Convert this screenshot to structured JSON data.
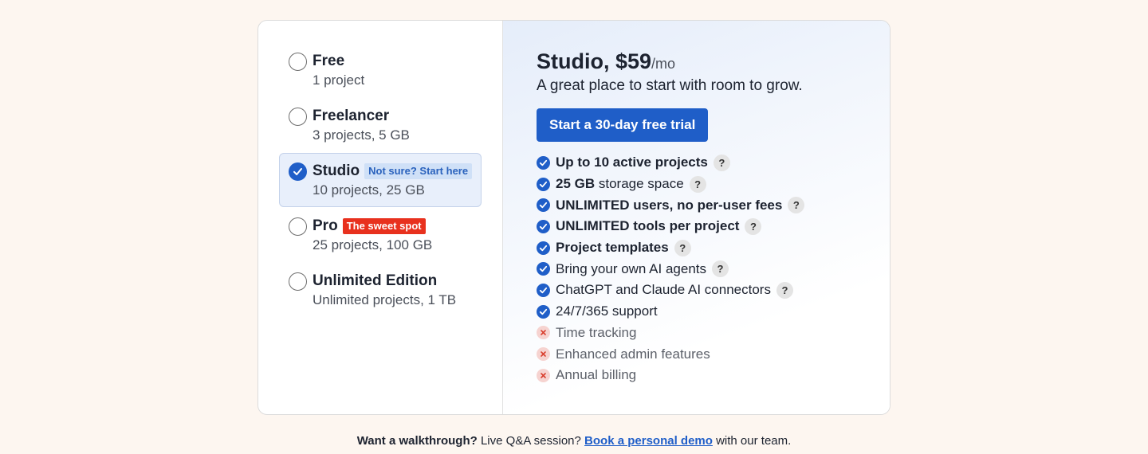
{
  "plans": [
    {
      "name": "Free",
      "desc": "1 project",
      "badge": "",
      "selected": false
    },
    {
      "name": "Freelancer",
      "desc": "3 projects, 5 GB",
      "badge": "",
      "selected": false
    },
    {
      "name": "Studio",
      "desc": "10 projects, 25 GB",
      "badge": "Not sure? Start here",
      "badge_color": "#cfe0f7",
      "selected": true
    },
    {
      "name": "Pro",
      "desc": "25 projects, 100 GB",
      "badge": "The sweet spot",
      "badge_color": "#e8311e",
      "selected": false
    },
    {
      "name": "Unlimited Edition",
      "desc": "Unlimited projects, 1 TB",
      "badge": "",
      "selected": false
    }
  ],
  "detail": {
    "title": "Studio, $59",
    "per": "/mo",
    "tagline": "A great place to start with room to grow.",
    "cta": "Start a 30-day free trial",
    "features": [
      {
        "bold": "Up to 10 active projects",
        "text": "",
        "included": true,
        "help": true
      },
      {
        "bold": "25 GB",
        "text": " storage space",
        "included": true,
        "help": true
      },
      {
        "bold": "UNLIMITED users, no per-user fees",
        "text": "",
        "included": true,
        "help": true
      },
      {
        "bold": "UNLIMITED tools per project",
        "text": "",
        "included": true,
        "help": true
      },
      {
        "bold": "Project templates",
        "text": "",
        "included": true,
        "help": true
      },
      {
        "bold": "",
        "text": "Bring your own AI agents",
        "included": true,
        "help": true
      },
      {
        "bold": "",
        "text": "ChatGPT and Claude AI connectors",
        "included": true,
        "help": true
      },
      {
        "bold": "",
        "text": "24/7/365 support",
        "included": true,
        "help": false
      },
      {
        "bold": "",
        "text": "Time tracking",
        "included": false,
        "help": false
      },
      {
        "bold": "",
        "text": "Enhanced admin features",
        "included": false,
        "help": false
      },
      {
        "bold": "",
        "text": "Annual billing",
        "included": false,
        "help": false
      }
    ],
    "help_glyph": "?"
  },
  "footer": {
    "lead": "Want a walkthrough?",
    "text": " Live Q&A session? ",
    "link": "Book a personal demo",
    "tail": " with our team."
  },
  "colors": {
    "accent": "#1f5ec8",
    "background": "#fdf6f0",
    "red_badge": "#e8311e"
  },
  "icons": {
    "selected_radio": "check-icon",
    "included": "check-circle-icon",
    "excluded": "x-circle-icon",
    "help": "question-icon"
  }
}
